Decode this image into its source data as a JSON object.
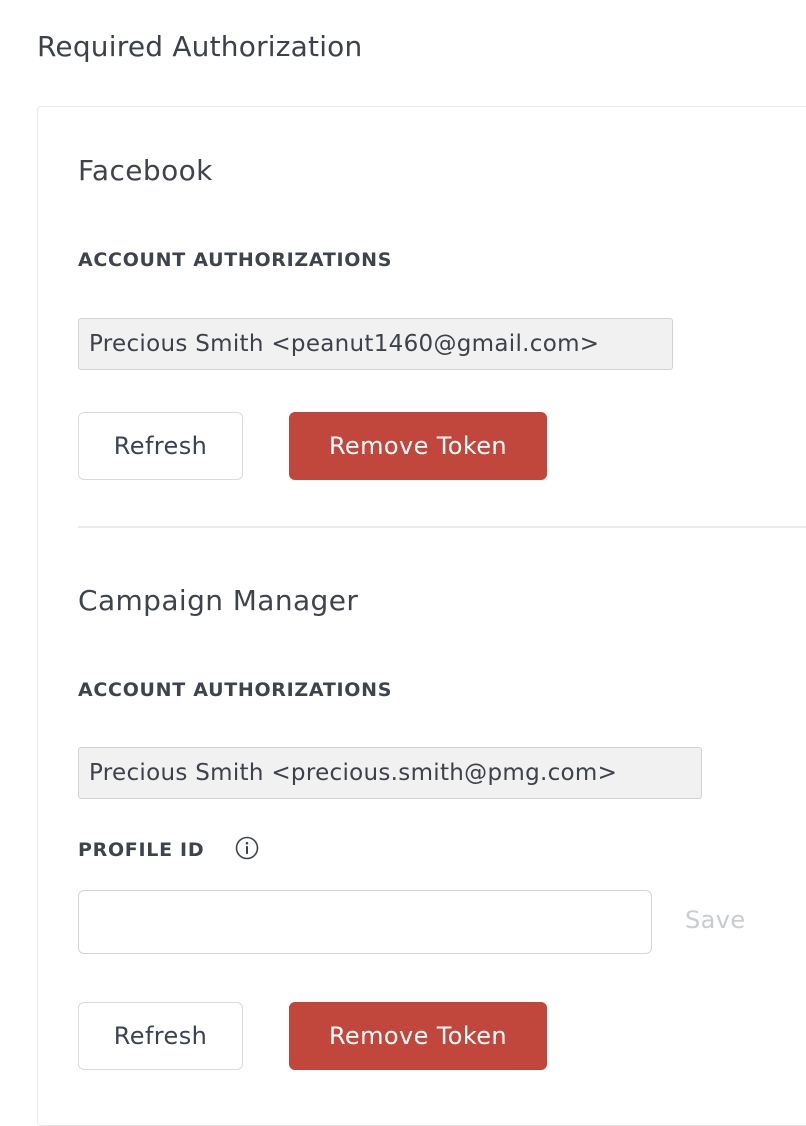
{
  "page": {
    "title": "Required Authorization"
  },
  "sections": [
    {
      "title": "Facebook",
      "account_label": "ACCOUNT AUTHORIZATIONS",
      "account_value": "Precious Smith <peanut1460@gmail.com>",
      "refresh_label": "Refresh",
      "remove_label": "Remove Token"
    },
    {
      "title": "Campaign Manager",
      "account_label": "ACCOUNT AUTHORIZATIONS",
      "account_value": "Precious Smith <precious.smith@pmg.com>",
      "profile_label": "PROFILE ID",
      "profile_value": "",
      "profile_placeholder": "",
      "save_label": "Save",
      "refresh_label": "Refresh",
      "remove_label": "Remove Token"
    }
  ],
  "icons": {
    "profile_info": "info-icon"
  },
  "colors": {
    "danger": "#c1473c",
    "disabled_text": "#c9ccd0",
    "readonly_bg": "#f1f1f2"
  }
}
